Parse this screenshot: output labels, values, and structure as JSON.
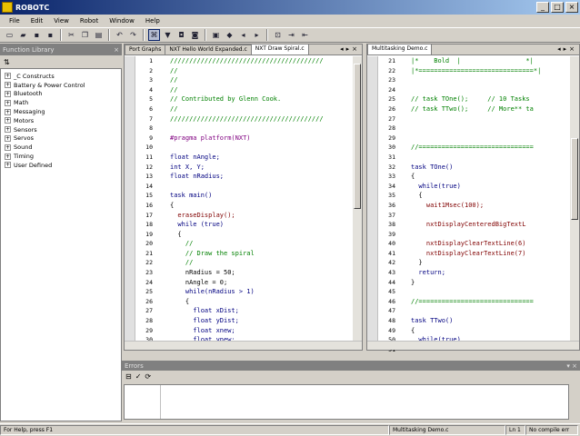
{
  "window": {
    "title": "ROBOTC",
    "min": "_",
    "max": "□",
    "close": "×"
  },
  "menu": [
    "File",
    "Edit",
    "View",
    "Robot",
    "Window",
    "Help"
  ],
  "toolbar_icons": [
    "new-icon",
    "open-icon",
    "save-icon",
    "save-all-icon",
    "cut-icon",
    "copy-icon",
    "paste-icon",
    "undo-icon",
    "redo-icon",
    "compile-icon",
    "debug-icon",
    "find-icon",
    "find-next-icon",
    "replace-icon",
    "bookmark-icon",
    "prev-bookmark-icon",
    "next-bookmark-icon",
    "clear-bookmarks-icon",
    "indent-icon",
    "outdent-icon"
  ],
  "left_panel": {
    "title": "Function Library",
    "close": "×",
    "tree": [
      "_C Constructs",
      "Battery & Power Control",
      "Bluetooth",
      "Math",
      "Messaging",
      "Motors",
      "Sensors",
      "Servos",
      "Sound",
      "Timing",
      "User Defined"
    ]
  },
  "editor_left": {
    "tabs": [
      "Port Graphs",
      "NXT Hello World Expanded.c",
      "NXT Draw Spiral.c"
    ],
    "active_tab": 2,
    "lines": [
      {
        "n": "1",
        "t": "////////////////////////////////////////",
        "c": "cm"
      },
      {
        "n": "2",
        "t": "//",
        "c": "cm"
      },
      {
        "n": "3",
        "t": "//",
        "c": "cm"
      },
      {
        "n": "4",
        "t": "//",
        "c": "cm"
      },
      {
        "n": "5",
        "t": "// Contributed by Glenn Cook.",
        "c": "cm"
      },
      {
        "n": "6",
        "t": "//",
        "c": "cm"
      },
      {
        "n": "7",
        "t": "////////////////////////////////////////",
        "c": "cm"
      },
      {
        "n": "8",
        "t": "",
        "c": ""
      },
      {
        "n": "9",
        "t": "#pragma platform(NXT)",
        "c": "pp"
      },
      {
        "n": "10",
        "t": "",
        "c": ""
      },
      {
        "n": "11",
        "t": "float nAngle;",
        "c": "kw"
      },
      {
        "n": "12",
        "t": "int X, Y;",
        "c": "kw"
      },
      {
        "n": "13",
        "t": "float nRadius;",
        "c": "kw"
      },
      {
        "n": "14",
        "t": "",
        "c": ""
      },
      {
        "n": "15",
        "t": "task main()",
        "c": "kw"
      },
      {
        "n": "16",
        "t": "{",
        "c": ""
      },
      {
        "n": "17",
        "t": "  eraseDisplay();",
        "c": "fn"
      },
      {
        "n": "18",
        "t": "  while (true)",
        "c": "kw"
      },
      {
        "n": "19",
        "t": "  {",
        "c": ""
      },
      {
        "n": "20",
        "t": "    //",
        "c": "cm"
      },
      {
        "n": "21",
        "t": "    // Draw the spiral",
        "c": "cm"
      },
      {
        "n": "22",
        "t": "    //",
        "c": "cm"
      },
      {
        "n": "23",
        "t": "    nRadius = 50;",
        "c": ""
      },
      {
        "n": "24",
        "t": "    nAngle = 0;",
        "c": ""
      },
      {
        "n": "25",
        "t": "    while(nRadius > 1)",
        "c": "kw"
      },
      {
        "n": "26",
        "t": "    {",
        "c": ""
      },
      {
        "n": "27",
        "t": "      float xDist;",
        "c": "kw"
      },
      {
        "n": "28",
        "t": "      float yDist;",
        "c": "kw"
      },
      {
        "n": "29",
        "t": "      float xnew;",
        "c": "kw"
      },
      {
        "n": "30",
        "t": "      float ynew;",
        "c": "kw"
      }
    ]
  },
  "editor_right": {
    "tabs": [
      "Multitasking Demo.c"
    ],
    "active_tab": 0,
    "lines": [
      {
        "n": "21",
        "t": "|*    Bold  |                 *|",
        "c": "cm"
      },
      {
        "n": "22",
        "t": "|*==============================*|",
        "c": "cm"
      },
      {
        "n": "23",
        "t": "",
        "c": ""
      },
      {
        "n": "24",
        "t": "",
        "c": ""
      },
      {
        "n": "25",
        "t": "// task TOne();     // 10 Tasks",
        "c": "cm"
      },
      {
        "n": "26",
        "t": "// task TTwo();     // More** ta",
        "c": "cm"
      },
      {
        "n": "27",
        "t": "",
        "c": ""
      },
      {
        "n": "28",
        "t": "",
        "c": ""
      },
      {
        "n": "29",
        "t": "",
        "c": ""
      },
      {
        "n": "30",
        "t": "//==============================",
        "c": "cm"
      },
      {
        "n": "31",
        "t": "",
        "c": ""
      },
      {
        "n": "32",
        "t": "task TOne()",
        "c": "kw"
      },
      {
        "n": "33",
        "t": "{",
        "c": ""
      },
      {
        "n": "34",
        "t": "  while(true)",
        "c": "kw"
      },
      {
        "n": "35",
        "t": "  {",
        "c": ""
      },
      {
        "n": "36",
        "t": "    wait1Msec(100);",
        "c": "fn"
      },
      {
        "n": "37",
        "t": "",
        "c": ""
      },
      {
        "n": "38",
        "t": "    nxtDisplayCenteredBigTextL",
        "c": "fn"
      },
      {
        "n": "39",
        "t": "",
        "c": ""
      },
      {
        "n": "40",
        "t": "    nxtDisplayClearTextLine(6)",
        "c": "fn"
      },
      {
        "n": "41",
        "t": "    nxtDisplayClearTextLine(7)",
        "c": "fn"
      },
      {
        "n": "42",
        "t": "  }",
        "c": ""
      },
      {
        "n": "43",
        "t": "  return;",
        "c": "kw"
      },
      {
        "n": "44",
        "t": "}",
        "c": ""
      },
      {
        "n": "45",
        "t": "",
        "c": ""
      },
      {
        "n": "46",
        "t": "//==============================",
        "c": "cm"
      },
      {
        "n": "47",
        "t": "",
        "c": ""
      },
      {
        "n": "48",
        "t": "task TTwo()",
        "c": "kw"
      },
      {
        "n": "49",
        "t": "{",
        "c": ""
      },
      {
        "n": "50",
        "t": "  while(true)",
        "c": "kw"
      },
      {
        "n": "51",
        "t": "  {",
        "c": ""
      }
    ]
  },
  "output": {
    "title": "Errors",
    "controls": "▾ ×"
  },
  "status": {
    "help": "For Help, press F1",
    "file": "Multitasking Demo.c",
    "pos": "Ln 1",
    "compile": "No compile err"
  }
}
